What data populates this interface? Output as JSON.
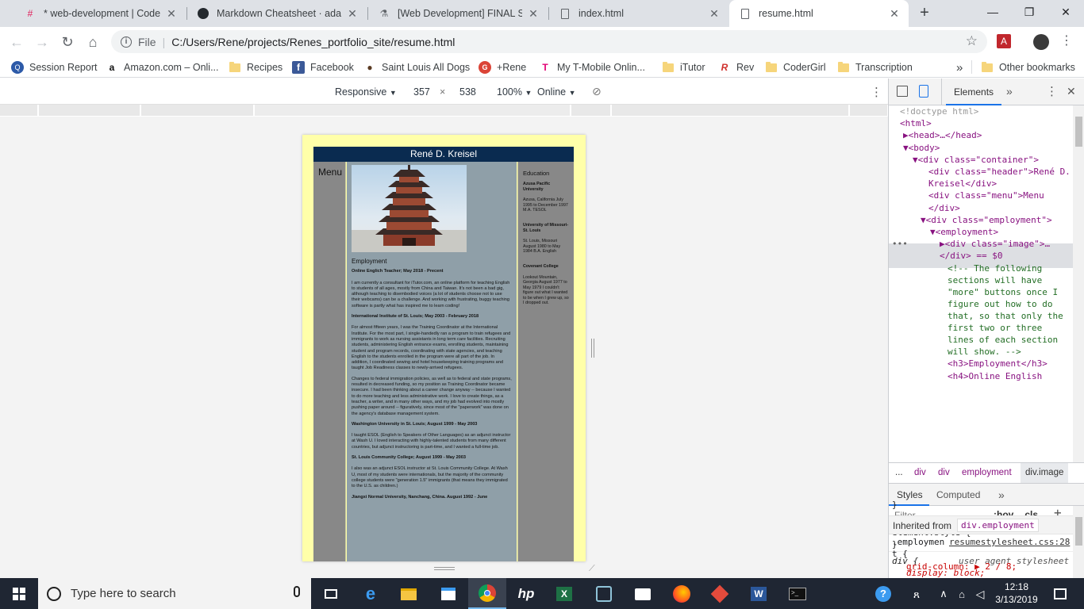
{
  "tabs": [
    {
      "label": "* web-development | CoderGir",
      "icon": "slack-icon",
      "active": false
    },
    {
      "label": "Markdown Cheatsheet · adam-",
      "icon": "github-icon",
      "active": false
    },
    {
      "label": "[Web Development] FINAL SU",
      "icon": "flask-icon",
      "active": false
    },
    {
      "label": "index.html",
      "icon": "file-icon",
      "active": false
    },
    {
      "label": "resume.html",
      "icon": "file-icon",
      "active": true
    }
  ],
  "omnibox": {
    "scheme_label": "File",
    "url": "C:/Users/Rene/projects/Renes_portfolio_site/resume.html"
  },
  "bookmarks": [
    {
      "label": "Session Report",
      "icon": "session-icon"
    },
    {
      "label": "Amazon.com – Onli...",
      "icon": "amazon-icon"
    },
    {
      "label": "Recipes",
      "icon": "folder-icon"
    },
    {
      "label": "Facebook",
      "icon": "facebook-icon"
    },
    {
      "label": "Saint Louis All Dogs",
      "icon": "paw-icon"
    },
    {
      "label": "+Rene",
      "icon": "google-icon"
    },
    {
      "label": "My T-Mobile Onlin...",
      "icon": "tmobile-icon"
    },
    {
      "label": "iTutor",
      "icon": "folder-icon"
    },
    {
      "label": "Rev",
      "icon": "rev-icon"
    },
    {
      "label": "CoderGirl",
      "icon": "folder-icon"
    },
    {
      "label": "Transcription",
      "icon": "folder-icon"
    }
  ],
  "bookmarks_more": "»",
  "other_bookmarks": "Other bookmarks",
  "device_toolbar": {
    "mode": "Responsive",
    "width": "357",
    "times": "×",
    "height": "538",
    "zoom": "100%",
    "network": "Online"
  },
  "page": {
    "header": "René D. Kreisel",
    "menu": "Menu",
    "employment_heading": "Employment",
    "jobs": [
      {
        "title": "Online Englich Teacher; May 2018 - Precent",
        "text": "I am currently a consultant for iTutor.com, an online platform for teaching English to students of all ages, mostly from China and Taiwan. It's not been a bad gig, although teaching to disembodied voices (a lot of students choose not to use their webcams) can be a challenge. And working with frustrating, buggy teaching software is partly what has inspired me to learn coding!"
      },
      {
        "title": "International Institute of St. Louis; May 2003 - February 2018",
        "text": "For almost fifteen years, I was the Training Coordinator at the International Institute. For the most part, I single-handedly ran a program to train refugees and immigrants to work as nursing assistants in long term care facilities. Recruiting students, administering English entrance exams, enrolling students, maintaining student and program records, coordinating with state agencies, and teaching English to the students enrolled in the program were all part of the job. In addition, I coordinated sewing and hotel housekeeping training programs and taught Job Readiness classes to newly-arrived refugees."
      },
      {
        "title": "",
        "text": "Changes to federal immigration policies, as well as to federal and state programs, resulted in decreased funding, so my position as Training Coordinator became insecure. I had been thinking about a career change anyway -- because I wanted to do more teaching and less administrative work. I love to create things, as a teacher, a writer, and in many other ways, and my job had evolved into mostly pushing paper around -- figuratively, since most of the \"paperwork\" was done on the agency's database management system."
      },
      {
        "title": "Washington University in St. Louis; August 1999 - May 2003",
        "text": "I taught ESOL (English to Speakers of Other Languages) as an adjunct instructor at Wash U. I loved interacting with highly-talented students from many different countries, but adjunct instructoring is part-time, and I wanted a full-time job."
      },
      {
        "title": "St. Louis Community College; August 1999 - May 2003",
        "text": "I also was an adjunct ESOL instructor at St. Louis Community College. At Wash U, most of my students were internationals, but the majority of the community college students were \"generation 1.5\" immigrants (that means they immigrated to the U.S. as children.)"
      },
      {
        "title": "Jiangxi Normal University, Nanchang, China. August 1992 - June",
        "text": ""
      }
    ],
    "education_heading": "Education",
    "schools": [
      {
        "name": "Azusa Pacific University",
        "detail": "Azusa, California July 1995 to December 1997 M.A. TESOL"
      },
      {
        "name": "University of Missouri- St. Louis",
        "detail": "St. Louis, Missouri August 1980 to May 1984 B.A. English"
      },
      {
        "name": "Covenant College",
        "detail": "Lookout Mountain, Georgia August 1977 to May 1979 I couldn't figure out what I wanted to be when I grew up, so I dropped out."
      }
    ]
  },
  "devtools": {
    "tab_elements": "Elements",
    "more": "»",
    "dom": [
      {
        "text": "<!doctype html>",
        "kind": "dim"
      },
      {
        "text": "<html>",
        "kind": "tag"
      },
      {
        "text": "▶<head>…</head>",
        "kind": "tag"
      },
      {
        "text": "▼<body>",
        "kind": "tag"
      },
      {
        "text": "▼<div class=\"container\">",
        "kind": "tag"
      },
      {
        "text": "<div class=\"header\">René D.",
        "kind": "tag"
      },
      {
        "text": "Kreisel</div>",
        "kind": "tag"
      },
      {
        "text": "<div class=\"menu\">Menu",
        "kind": "tag"
      },
      {
        "text": "</div>",
        "kind": "tag"
      },
      {
        "text": "▼<div class=\"employment\">",
        "kind": "tag"
      },
      {
        "text": "▼<employment>",
        "kind": "tag"
      },
      {
        "text": "▶<div class=\"image\">…",
        "kind": "selected"
      },
      {
        "text": "</div> == $0",
        "kind": "selected"
      },
      {
        "text": "<!-- The following",
        "kind": "comment"
      },
      {
        "text": "sections will have",
        "kind": "comment"
      },
      {
        "text": "\"more\" buttons once I",
        "kind": "comment"
      },
      {
        "text": "figure out how to do",
        "kind": "comment"
      },
      {
        "text": "that, so that only the",
        "kind": "comment"
      },
      {
        "text": "first two or three",
        "kind": "comment"
      },
      {
        "text": "lines of each section",
        "kind": "comment"
      },
      {
        "text": "will show. -->",
        "kind": "comment"
      },
      {
        "text": "<h3>Employment</h3>",
        "kind": "tag"
      },
      {
        "text": "<h4>Online English",
        "kind": "tag"
      }
    ],
    "crumbs": [
      "...",
      "div",
      "div",
      "employment",
      "div.image"
    ],
    "styles_tab": "Styles",
    "computed_tab": "Computed",
    "filter_placeholder": "Filter",
    "hov": ":hov",
    "cls": ".cls",
    "rules": [
      "element.style {",
      "}",
      "div {",
      "user agent stylesheet",
      "display: block;",
      "}",
      "Inherited from",
      "div.employment",
      ".employmen",
      "resumestylesheet.css:28",
      "t {",
      "grid-column: ▶ 2 / 8;"
    ]
  },
  "taskbar": {
    "search_placeholder": "Type here to search",
    "time": "12:18",
    "date": "3/13/2019"
  }
}
